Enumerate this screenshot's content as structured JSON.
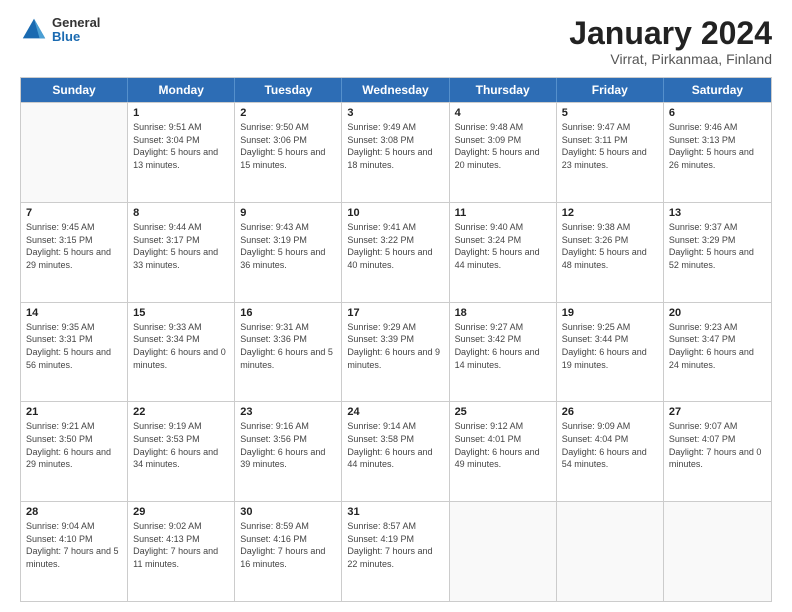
{
  "header": {
    "logo": {
      "general": "General",
      "blue": "Blue"
    },
    "title": "January 2024",
    "subtitle": "Virrat, Pirkanmaa, Finland"
  },
  "weekdays": [
    "Sunday",
    "Monday",
    "Tuesday",
    "Wednesday",
    "Thursday",
    "Friday",
    "Saturday"
  ],
  "weeks": [
    [
      {
        "day": "",
        "sunrise": "",
        "sunset": "",
        "daylight": ""
      },
      {
        "day": "1",
        "sunrise": "9:51 AM",
        "sunset": "3:04 PM",
        "daylight": "5 hours and 13 minutes."
      },
      {
        "day": "2",
        "sunrise": "9:50 AM",
        "sunset": "3:06 PM",
        "daylight": "5 hours and 15 minutes."
      },
      {
        "day": "3",
        "sunrise": "9:49 AM",
        "sunset": "3:08 PM",
        "daylight": "5 hours and 18 minutes."
      },
      {
        "day": "4",
        "sunrise": "9:48 AM",
        "sunset": "3:09 PM",
        "daylight": "5 hours and 20 minutes."
      },
      {
        "day": "5",
        "sunrise": "9:47 AM",
        "sunset": "3:11 PM",
        "daylight": "5 hours and 23 minutes."
      },
      {
        "day": "6",
        "sunrise": "9:46 AM",
        "sunset": "3:13 PM",
        "daylight": "5 hours and 26 minutes."
      }
    ],
    [
      {
        "day": "7",
        "sunrise": "9:45 AM",
        "sunset": "3:15 PM",
        "daylight": "5 hours and 29 minutes."
      },
      {
        "day": "8",
        "sunrise": "9:44 AM",
        "sunset": "3:17 PM",
        "daylight": "5 hours and 33 minutes."
      },
      {
        "day": "9",
        "sunrise": "9:43 AM",
        "sunset": "3:19 PM",
        "daylight": "5 hours and 36 minutes."
      },
      {
        "day": "10",
        "sunrise": "9:41 AM",
        "sunset": "3:22 PM",
        "daylight": "5 hours and 40 minutes."
      },
      {
        "day": "11",
        "sunrise": "9:40 AM",
        "sunset": "3:24 PM",
        "daylight": "5 hours and 44 minutes."
      },
      {
        "day": "12",
        "sunrise": "9:38 AM",
        "sunset": "3:26 PM",
        "daylight": "5 hours and 48 minutes."
      },
      {
        "day": "13",
        "sunrise": "9:37 AM",
        "sunset": "3:29 PM",
        "daylight": "5 hours and 52 minutes."
      }
    ],
    [
      {
        "day": "14",
        "sunrise": "9:35 AM",
        "sunset": "3:31 PM",
        "daylight": "5 hours and 56 minutes."
      },
      {
        "day": "15",
        "sunrise": "9:33 AM",
        "sunset": "3:34 PM",
        "daylight": "6 hours and 0 minutes."
      },
      {
        "day": "16",
        "sunrise": "9:31 AM",
        "sunset": "3:36 PM",
        "daylight": "6 hours and 5 minutes."
      },
      {
        "day": "17",
        "sunrise": "9:29 AM",
        "sunset": "3:39 PM",
        "daylight": "6 hours and 9 minutes."
      },
      {
        "day": "18",
        "sunrise": "9:27 AM",
        "sunset": "3:42 PM",
        "daylight": "6 hours and 14 minutes."
      },
      {
        "day": "19",
        "sunrise": "9:25 AM",
        "sunset": "3:44 PM",
        "daylight": "6 hours and 19 minutes."
      },
      {
        "day": "20",
        "sunrise": "9:23 AM",
        "sunset": "3:47 PM",
        "daylight": "6 hours and 24 minutes."
      }
    ],
    [
      {
        "day": "21",
        "sunrise": "9:21 AM",
        "sunset": "3:50 PM",
        "daylight": "6 hours and 29 minutes."
      },
      {
        "day": "22",
        "sunrise": "9:19 AM",
        "sunset": "3:53 PM",
        "daylight": "6 hours and 34 minutes."
      },
      {
        "day": "23",
        "sunrise": "9:16 AM",
        "sunset": "3:56 PM",
        "daylight": "6 hours and 39 minutes."
      },
      {
        "day": "24",
        "sunrise": "9:14 AM",
        "sunset": "3:58 PM",
        "daylight": "6 hours and 44 minutes."
      },
      {
        "day": "25",
        "sunrise": "9:12 AM",
        "sunset": "4:01 PM",
        "daylight": "6 hours and 49 minutes."
      },
      {
        "day": "26",
        "sunrise": "9:09 AM",
        "sunset": "4:04 PM",
        "daylight": "6 hours and 54 minutes."
      },
      {
        "day": "27",
        "sunrise": "9:07 AM",
        "sunset": "4:07 PM",
        "daylight": "7 hours and 0 minutes."
      }
    ],
    [
      {
        "day": "28",
        "sunrise": "9:04 AM",
        "sunset": "4:10 PM",
        "daylight": "7 hours and 5 minutes."
      },
      {
        "day": "29",
        "sunrise": "9:02 AM",
        "sunset": "4:13 PM",
        "daylight": "7 hours and 11 minutes."
      },
      {
        "day": "30",
        "sunrise": "8:59 AM",
        "sunset": "4:16 PM",
        "daylight": "7 hours and 16 minutes."
      },
      {
        "day": "31",
        "sunrise": "8:57 AM",
        "sunset": "4:19 PM",
        "daylight": "7 hours and 22 minutes."
      },
      {
        "day": "",
        "sunrise": "",
        "sunset": "",
        "daylight": ""
      },
      {
        "day": "",
        "sunrise": "",
        "sunset": "",
        "daylight": ""
      },
      {
        "day": "",
        "sunrise": "",
        "sunset": "",
        "daylight": ""
      }
    ]
  ]
}
